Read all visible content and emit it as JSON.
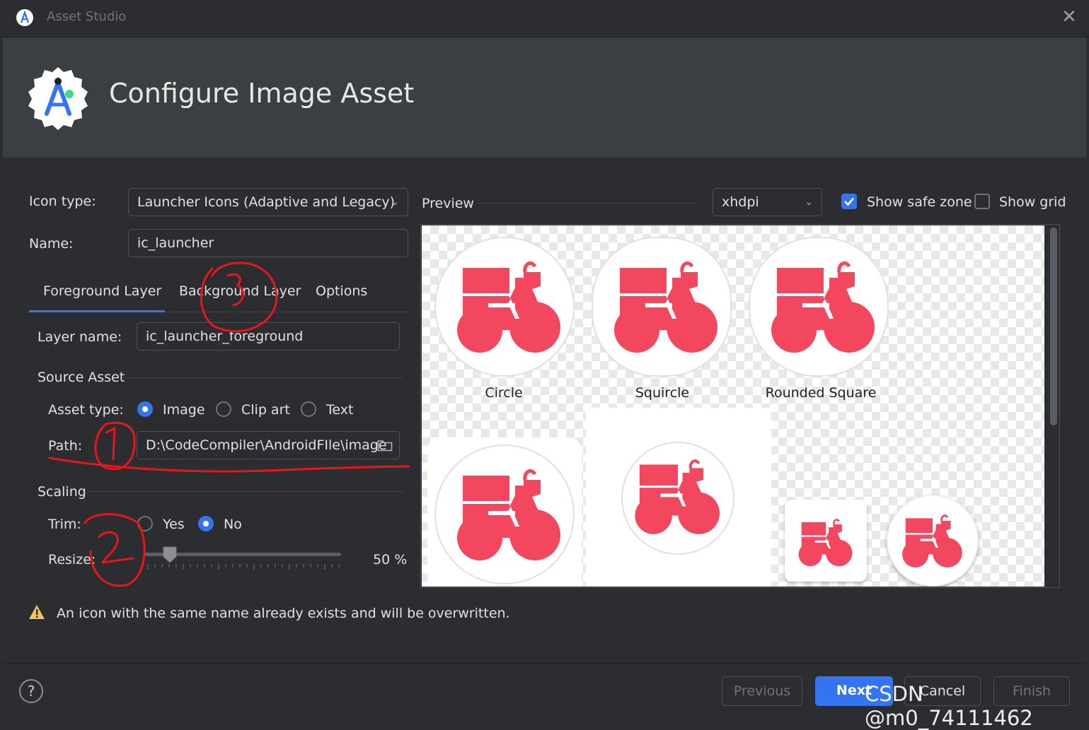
{
  "window": {
    "title": "Asset Studio"
  },
  "header": {
    "title": "Configure Image Asset"
  },
  "form": {
    "icon_type_label": "Icon type:",
    "icon_type_value": "Launcher Icons (Adaptive and Legacy)",
    "name_label": "Name:",
    "name_value": "ic_launcher"
  },
  "tabs": [
    {
      "label": "Foreground Layer",
      "active": true
    },
    {
      "label": "Background Layer",
      "active": false
    },
    {
      "label": "Options",
      "active": false
    }
  ],
  "layer": {
    "layer_name_label": "Layer name:",
    "layer_name_value": "ic_launcher_foreground",
    "source_asset_heading": "Source Asset",
    "asset_type_label": "Asset type:",
    "asset_type_options": [
      "Image",
      "Clip art",
      "Text"
    ],
    "asset_type_selected": "Image",
    "path_label": "Path:",
    "path_value": "D:\\CodeCompiler\\AndroidFIle\\image",
    "scaling_heading": "Scaling",
    "trim_label": "Trim:",
    "trim_options": [
      "Yes",
      "No"
    ],
    "trim_selected": "No",
    "resize_label": "Resize:",
    "resize_value": "50 %",
    "resize_percent": 50
  },
  "preview": {
    "label": "Preview",
    "density_value": "xhdpi",
    "show_safe_zone_label": "Show safe zone",
    "show_safe_zone_checked": true,
    "show_grid_label": "Show grid",
    "show_grid_checked": false,
    "shape_labels": [
      "Circle",
      "Squircle",
      "Rounded Square"
    ]
  },
  "warning": {
    "text": "An icon with the same name already exists and will be overwritten.",
    "icon": "warning-icon"
  },
  "footer": {
    "previous_label": "Previous",
    "next_label": "Next",
    "cancel_label": "Cancel",
    "finish_label": "Finish",
    "help_label": "?"
  },
  "watermark": {
    "text": "CSDN @m0_74111462"
  },
  "colors": {
    "accent": "#3574f0",
    "glyph": "#f2475f",
    "annotation": "#e8161c"
  }
}
